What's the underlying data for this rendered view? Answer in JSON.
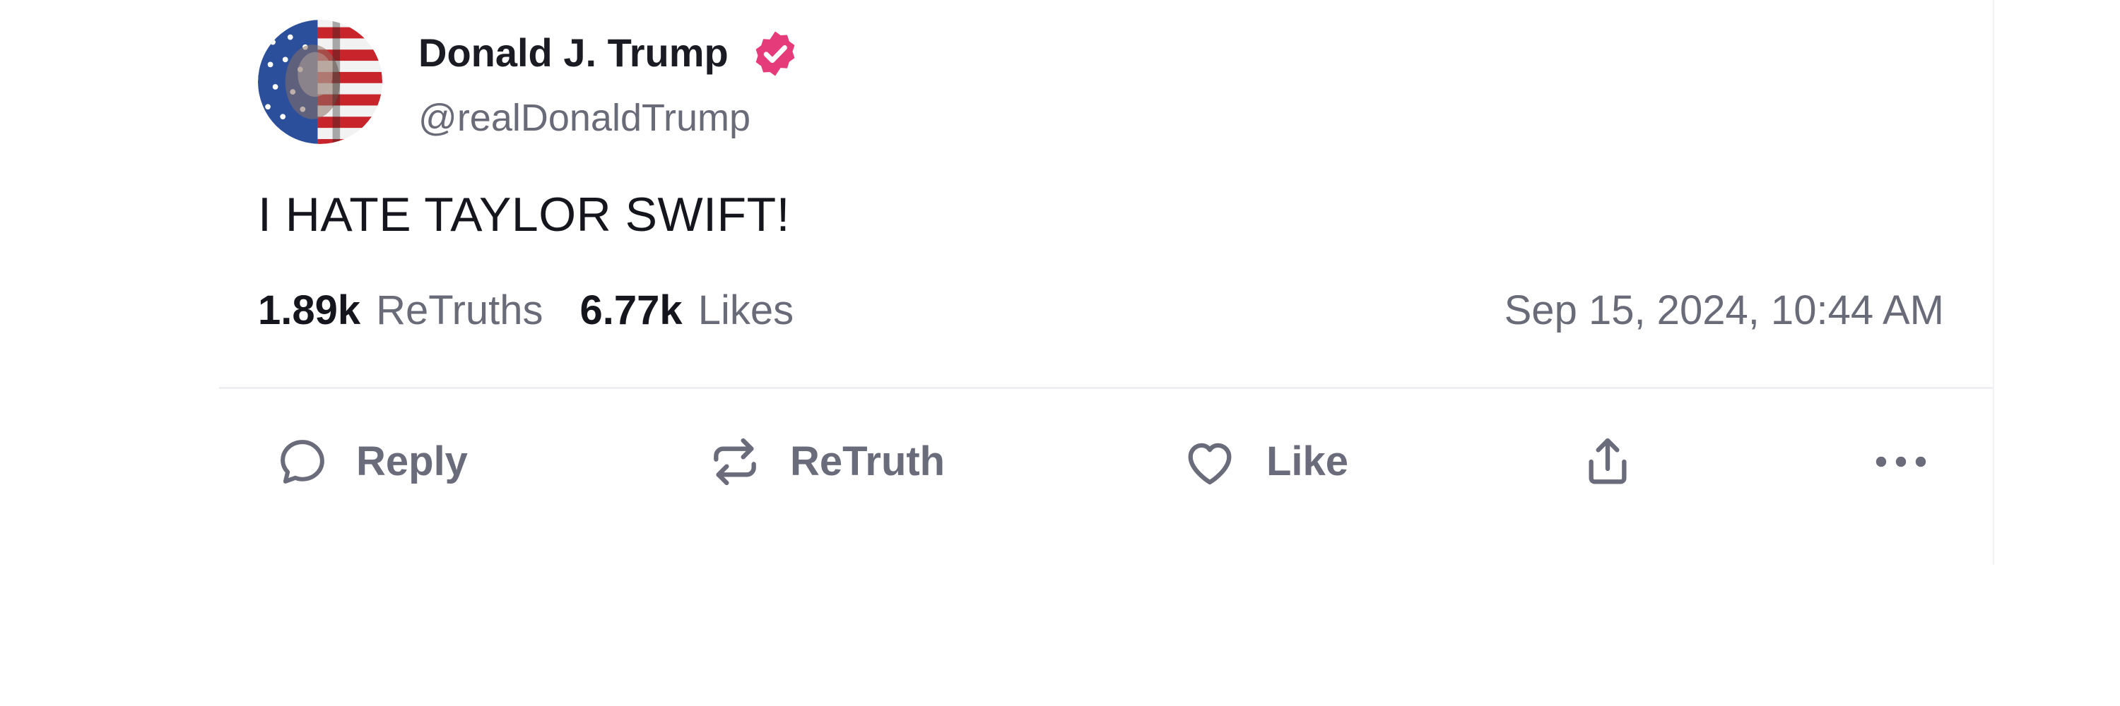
{
  "author": {
    "display_name": "Donald J. Trump",
    "handle": "@realDonaldTrump",
    "verified": true,
    "verified_badge_color": "#e63b7a",
    "avatar_icon": "flag-portrait-avatar"
  },
  "post": {
    "text": "I HATE TAYLOR SWIFT!",
    "timestamp": "Sep 15, 2024, 10:44 AM"
  },
  "stats": {
    "retruths_count": "1.89k",
    "retruths_label": "ReTruths",
    "likes_count": "6.77k",
    "likes_label": "Likes"
  },
  "actions": {
    "reply": {
      "label": "Reply",
      "icon": "speech-bubble-icon"
    },
    "retruth": {
      "label": "ReTruth",
      "icon": "repost-arrows-icon"
    },
    "like": {
      "label": "Like",
      "icon": "heart-icon"
    },
    "share": {
      "icon": "share-upload-icon"
    },
    "more": {
      "icon": "ellipsis-icon"
    }
  },
  "colors": {
    "text_primary": "#15151d",
    "text_secondary": "#6a6b78",
    "icon_gray": "#6a6b7b",
    "divider": "#efeff3"
  }
}
